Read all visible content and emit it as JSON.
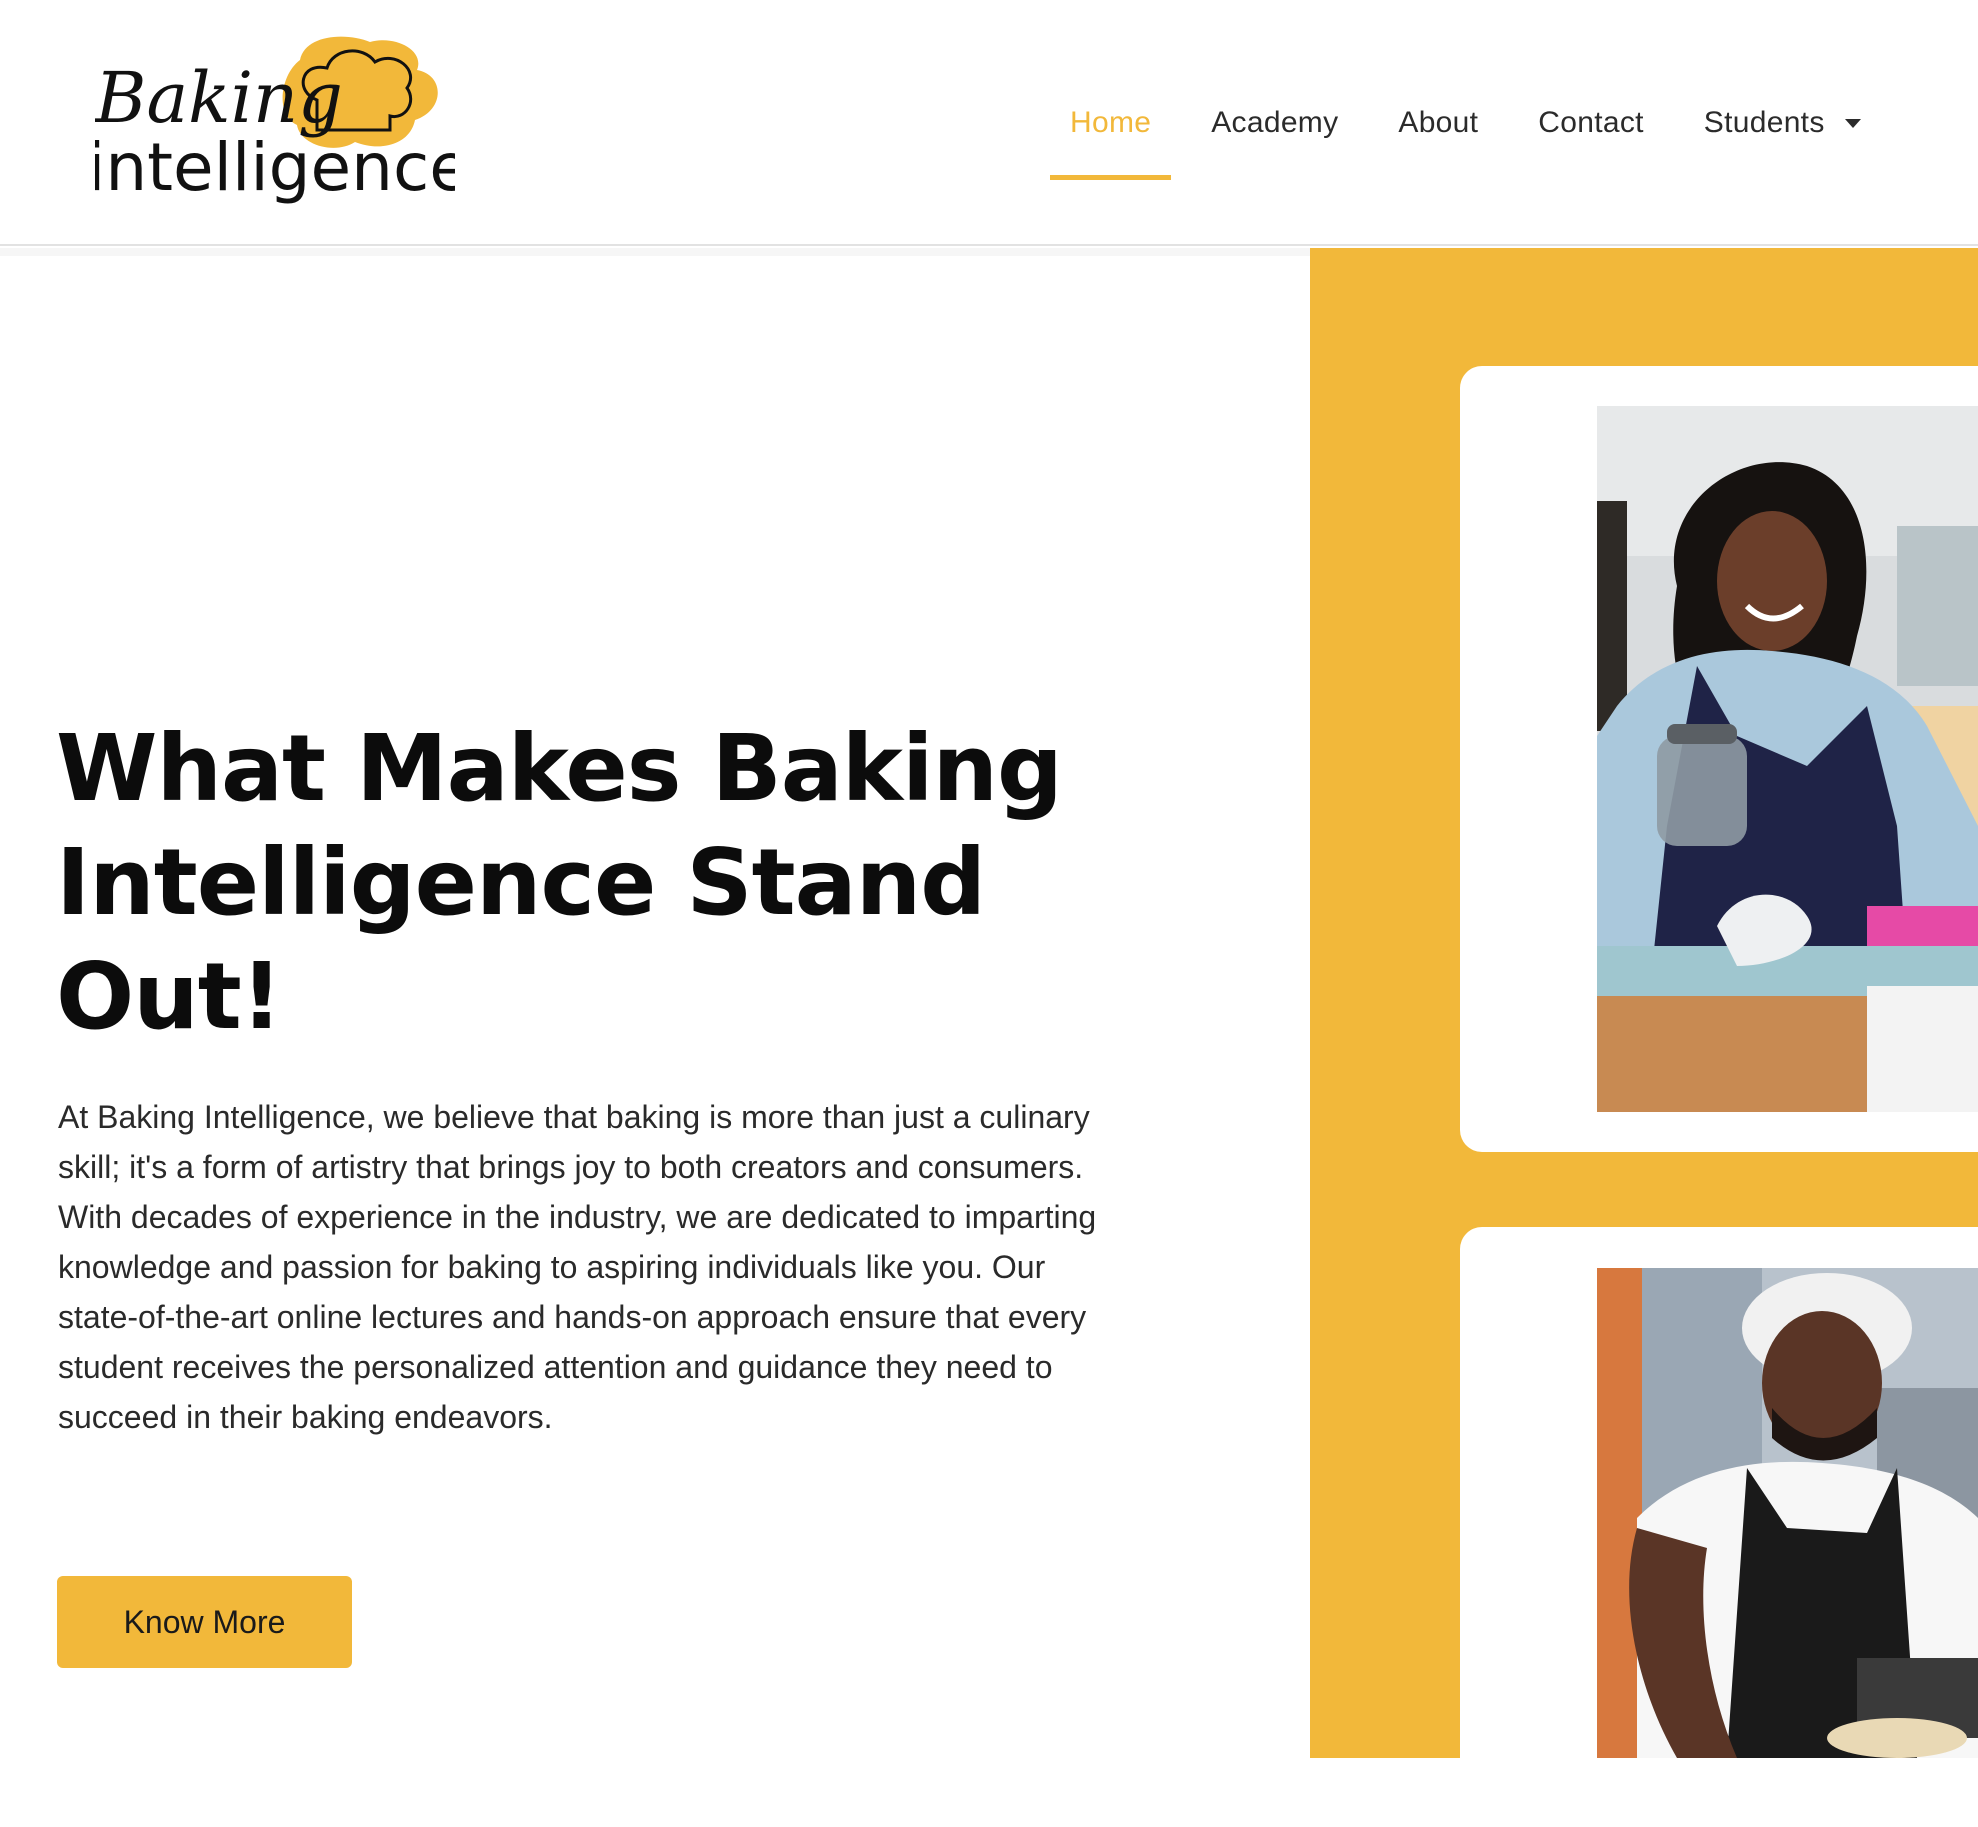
{
  "header": {
    "logo": {
      "line1": "Baking",
      "line2": "intelligence",
      "icon": "chef-hat-icon",
      "brand_color": "#f2b83a"
    },
    "nav": {
      "items": [
        {
          "label": "Home",
          "active": true
        },
        {
          "label": "Academy",
          "active": false
        },
        {
          "label": "About",
          "active": false
        },
        {
          "label": "Contact",
          "active": false
        },
        {
          "label": "Students",
          "active": false,
          "has_dropdown": true
        }
      ],
      "dropdown_icon": "caret-down-icon"
    }
  },
  "hero": {
    "headline": "What Makes Baking Intelligence Stand Out!",
    "paragraph": "At Baking Intelligence, we believe that baking is more than just a culinary skill; it's a form of artistry that brings joy to both creators and consumers. With decades of experience in the industry, we are dedicated to imparting knowledge and passion for baking to aspiring individuals like you. Our state-of-the-art online lectures and hands-on approach ensure that every student receives the personalized attention and guidance they need to succeed in their baking endeavors.",
    "cta_label": "Know More"
  },
  "gallery": {
    "photos": [
      {
        "alt": "Smiling baker in navy apron holding a glass jar in a kitchen class"
      },
      {
        "alt": "Baker in hairnet and black apron working at a counter"
      }
    ]
  },
  "colors": {
    "accent": "#f2b83a",
    "text": "#0c0c0c",
    "nav_text": "#2b2b2b"
  }
}
